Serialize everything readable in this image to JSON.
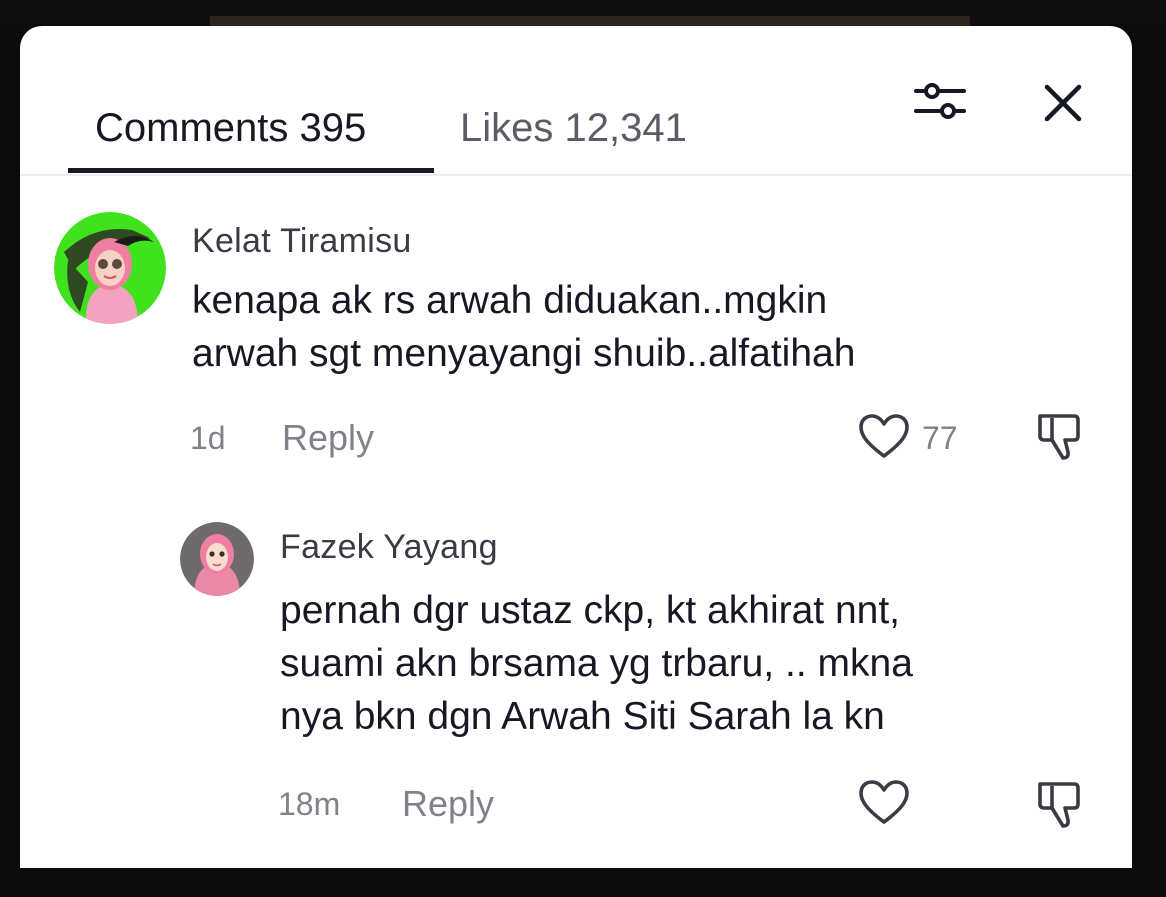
{
  "header": {
    "tabs": [
      {
        "label": "Comments 395",
        "active": true
      },
      {
        "label": "Likes 12,341",
        "active": false
      }
    ],
    "filter_icon": "sliders-icon",
    "close_icon": "close-icon"
  },
  "comments": [
    {
      "username": "Kelat Tiramisu",
      "text": "kenapa ak rs arwah diduakan..mgkin\narwah sgt menyayangi shuib..alfatihah",
      "time": "1d",
      "reply_label": "Reply",
      "likes": "77",
      "avatar": "avatar-kelat-tiramisu",
      "avatar_color": "#3fe21c",
      "replies": [
        {
          "username": "Fazek Yayang",
          "text": "pernah dgr ustaz ckp, kt akhirat nnt,\nsuami akn brsama yg trbaru, .. mkna\nnya bkn dgn Arwah Siti Sarah la kn",
          "time": "18m",
          "reply_label": "Reply",
          "likes": "",
          "avatar": "avatar-fazek-yayang",
          "avatar_color": "#e889a6"
        }
      ]
    }
  ],
  "colors": {
    "text_primary": "#161823",
    "text_secondary": "#80828a",
    "accent_green": "#3fe21c",
    "accent_pink": "#f07ea2"
  }
}
